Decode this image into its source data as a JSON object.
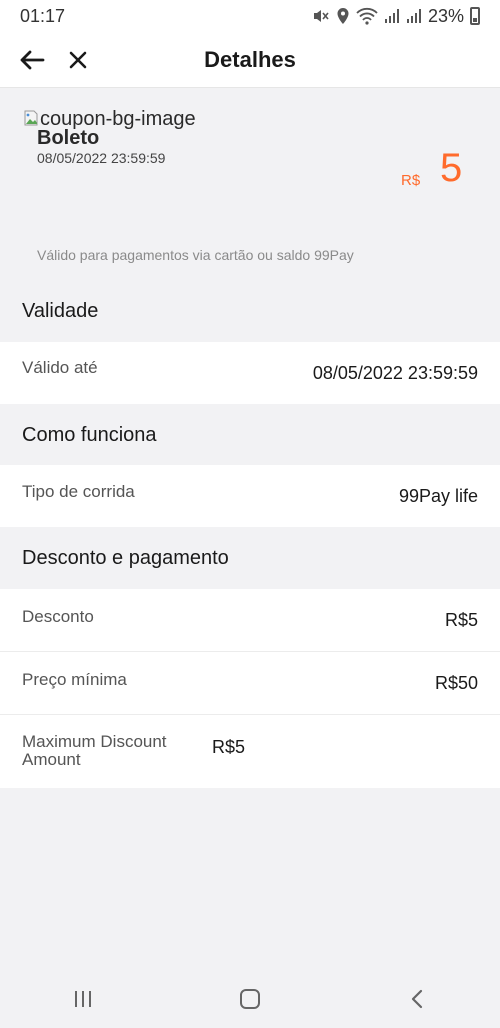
{
  "status": {
    "time": "01:17",
    "battery": "23%",
    "icons": [
      "mute-icon",
      "location-icon",
      "wifi-icon",
      "signal-icon",
      "signal-icon",
      "battery-icon"
    ]
  },
  "header": {
    "title": "Detalhes",
    "back_icon": "back-arrow-icon",
    "close_icon": "close-icon"
  },
  "coupon": {
    "image_alt": "coupon-bg-image",
    "title": "Boleto",
    "date": "08/05/2022 23:59:59",
    "currency": "R$",
    "value": "5",
    "note": "Válido para pagamentos via cartão ou saldo 99Pay",
    "accent_color": "#ff6b2c"
  },
  "sections": [
    {
      "title": "Validade",
      "rows": [
        {
          "label": "Válido até",
          "value": "08/05/2022 23:59:59"
        }
      ]
    },
    {
      "title": "Como funciona",
      "rows": [
        {
          "label": "Tipo de corrida",
          "value": "99Pay life"
        }
      ]
    },
    {
      "title": "Desconto e pagamento",
      "rows": [
        {
          "label": "Desconto",
          "value": "R$5"
        },
        {
          "label": "Preço mínima",
          "value": "R$50"
        },
        {
          "label": "Maximum Discount Amount",
          "value": "R$5"
        }
      ]
    }
  ],
  "nav": {
    "recents_icon": "recents-icon",
    "home_icon": "home-icon",
    "back_icon": "back-chevron-icon"
  }
}
